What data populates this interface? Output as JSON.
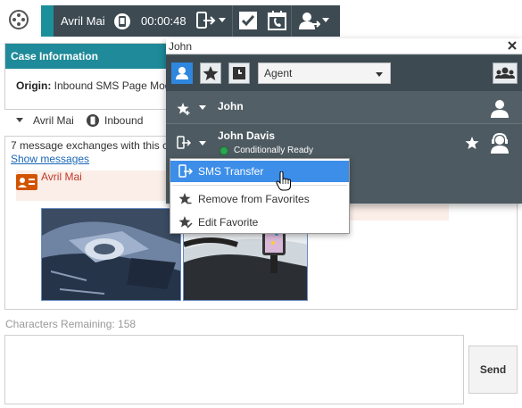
{
  "toolbar": {
    "caller_name": "Avril Mai",
    "timer": "00:00:48",
    "accent_color": "#1b8f9a",
    "bar_color": "#3d4a52",
    "icons": [
      "workspace-logo-icon",
      "phone-icon",
      "transfer-icon",
      "mark-done-icon",
      "schedule-callback-icon",
      "consult-icon"
    ]
  },
  "case": {
    "header": "Case Information",
    "origin_label": "Origin:",
    "origin_value": "Inbound SMS Page Mod"
  },
  "party": {
    "name": "Avril Mai",
    "direction": "Inbound"
  },
  "transcript": {
    "exchanges_text": "7 message exchanges with this c",
    "show_messages": "Show messages",
    "author": "Avril Mai"
  },
  "compose": {
    "chars_remaining": "Characters Remaining: 158",
    "send_label": "Send"
  },
  "team_communicator": {
    "search_value": "John",
    "filter_selected": "Agent",
    "results": [
      {
        "name": "John",
        "status": ""
      },
      {
        "name": "John Davis",
        "status": "Conditionally Ready"
      }
    ],
    "status_ready_color": "#2ea44f"
  },
  "context_menu": {
    "items": [
      "SMS Transfer",
      "Remove from Favorites",
      "Edit Favorite"
    ],
    "highlight_color": "#3c8ee8"
  }
}
